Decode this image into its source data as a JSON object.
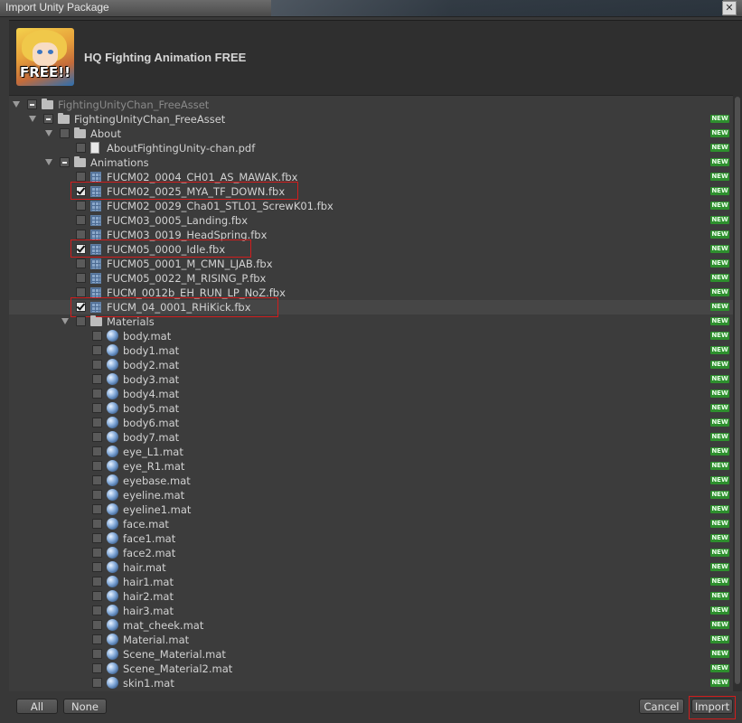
{
  "window": {
    "title": "Import Unity Package"
  },
  "package": {
    "name": "HQ Fighting Animation FREE",
    "logo_text": "FREE!!"
  },
  "new_badge": "NEW",
  "tree": {
    "rows": [
      {
        "label": "FightingUnityChan_FreeAsset",
        "indent": 0,
        "icon": "folder-icon",
        "check": "mixed",
        "expanded": true,
        "dim": true,
        "new": false
      },
      {
        "label": "FightingUnityChan_FreeAsset",
        "indent": 1,
        "icon": "folder-icon",
        "check": "mixed",
        "expanded": true,
        "new": true
      },
      {
        "label": "About",
        "indent": 2,
        "icon": "folder-icon",
        "check": "unchecked",
        "expanded": true,
        "new": true
      },
      {
        "label": "AboutFightingUnity-chan.pdf",
        "indent": 3,
        "icon": "document-icon",
        "check": "unchecked",
        "new": true
      },
      {
        "label": "Animations",
        "indent": 2,
        "icon": "folder-icon",
        "check": "mixed",
        "expanded": true,
        "new": true
      },
      {
        "label": "FUCM02_0004_CH01_AS_MAWAK.fbx",
        "indent": 3,
        "icon": "mesh-icon",
        "check": "unchecked",
        "new": true
      },
      {
        "label": "FUCM02_0025_MYA_TF_DOWN.fbx",
        "indent": 3,
        "icon": "mesh-icon",
        "check": "checked",
        "new": true,
        "highlight": true
      },
      {
        "label": "FUCM02_0029_Cha01_STL01_ScrewK01.fbx",
        "indent": 3,
        "icon": "mesh-icon",
        "check": "unchecked",
        "new": true
      },
      {
        "label": "FUCM03_0005_Landing.fbx",
        "indent": 3,
        "icon": "mesh-icon",
        "check": "unchecked",
        "new": true
      },
      {
        "label": "FUCM03_0019_HeadSpring.fbx",
        "indent": 3,
        "icon": "mesh-icon",
        "check": "unchecked",
        "new": true
      },
      {
        "label": "FUCM05_0000_Idle.fbx",
        "indent": 3,
        "icon": "mesh-icon",
        "check": "checked",
        "new": true,
        "highlight": true
      },
      {
        "label": "FUCM05_0001_M_CMN_LJAB.fbx",
        "indent": 3,
        "icon": "mesh-icon",
        "check": "unchecked",
        "new": true
      },
      {
        "label": "FUCM05_0022_M_RISING_P.fbx",
        "indent": 3,
        "icon": "mesh-icon",
        "check": "unchecked",
        "new": true
      },
      {
        "label": "FUCM_0012b_EH_RUN_LP_NoZ.fbx",
        "indent": 3,
        "icon": "mesh-icon",
        "check": "unchecked",
        "new": true
      },
      {
        "label": "FUCM_04_0001_RHiKick.fbx",
        "indent": 3,
        "icon": "mesh-icon",
        "check": "checked",
        "new": true,
        "highlight": true,
        "selected": true
      },
      {
        "label": "Materials",
        "indent": 3,
        "icon": "folder-icon",
        "check": "unchecked",
        "expanded": true,
        "new": true
      },
      {
        "label": "body.mat",
        "indent": 4,
        "icon": "material-icon",
        "check": "unchecked",
        "new": true
      },
      {
        "label": "body1.mat",
        "indent": 4,
        "icon": "material-icon",
        "check": "unchecked",
        "new": true
      },
      {
        "label": "body2.mat",
        "indent": 4,
        "icon": "material-icon",
        "check": "unchecked",
        "new": true
      },
      {
        "label": "body3.mat",
        "indent": 4,
        "icon": "material-icon",
        "check": "unchecked",
        "new": true
      },
      {
        "label": "body4.mat",
        "indent": 4,
        "icon": "material-icon",
        "check": "unchecked",
        "new": true
      },
      {
        "label": "body5.mat",
        "indent": 4,
        "icon": "material-icon",
        "check": "unchecked",
        "new": true
      },
      {
        "label": "body6.mat",
        "indent": 4,
        "icon": "material-icon",
        "check": "unchecked",
        "new": true
      },
      {
        "label": "body7.mat",
        "indent": 4,
        "icon": "material-icon",
        "check": "unchecked",
        "new": true
      },
      {
        "label": "eye_L1.mat",
        "indent": 4,
        "icon": "material-icon",
        "check": "unchecked",
        "new": true
      },
      {
        "label": "eye_R1.mat",
        "indent": 4,
        "icon": "material-icon",
        "check": "unchecked",
        "new": true
      },
      {
        "label": "eyebase.mat",
        "indent": 4,
        "icon": "material-icon",
        "check": "unchecked",
        "new": true
      },
      {
        "label": "eyeline.mat",
        "indent": 4,
        "icon": "material-icon",
        "check": "unchecked",
        "new": true
      },
      {
        "label": "eyeline1.mat",
        "indent": 4,
        "icon": "material-icon",
        "check": "unchecked",
        "new": true
      },
      {
        "label": "face.mat",
        "indent": 4,
        "icon": "material-icon",
        "check": "unchecked",
        "new": true
      },
      {
        "label": "face1.mat",
        "indent": 4,
        "icon": "material-icon",
        "check": "unchecked",
        "new": true
      },
      {
        "label": "face2.mat",
        "indent": 4,
        "icon": "material-icon",
        "check": "unchecked",
        "new": true
      },
      {
        "label": "hair.mat",
        "indent": 4,
        "icon": "material-icon",
        "check": "unchecked",
        "new": true
      },
      {
        "label": "hair1.mat",
        "indent": 4,
        "icon": "material-icon",
        "check": "unchecked",
        "new": true
      },
      {
        "label": "hair2.mat",
        "indent": 4,
        "icon": "material-icon",
        "check": "unchecked",
        "new": true
      },
      {
        "label": "hair3.mat",
        "indent": 4,
        "icon": "material-icon",
        "check": "unchecked",
        "new": true
      },
      {
        "label": "mat_cheek.mat",
        "indent": 4,
        "icon": "material-icon",
        "check": "unchecked",
        "new": true
      },
      {
        "label": "Material.mat",
        "indent": 4,
        "icon": "material-icon",
        "check": "unchecked",
        "new": true
      },
      {
        "label": "Scene_Material.mat",
        "indent": 4,
        "icon": "material-icon",
        "check": "unchecked",
        "new": true
      },
      {
        "label": "Scene_Material2.mat",
        "indent": 4,
        "icon": "material-icon",
        "check": "unchecked",
        "new": true
      },
      {
        "label": "skin1.mat",
        "indent": 4,
        "icon": "material-icon",
        "check": "unchecked",
        "new": true
      }
    ]
  },
  "footer": {
    "all_label": "All",
    "none_label": "None",
    "cancel_label": "Cancel",
    "import_label": "Import"
  },
  "colors": {
    "new_badge": "#2e8f2e",
    "annotation_red": "#d11d1d",
    "background": "#383838"
  }
}
